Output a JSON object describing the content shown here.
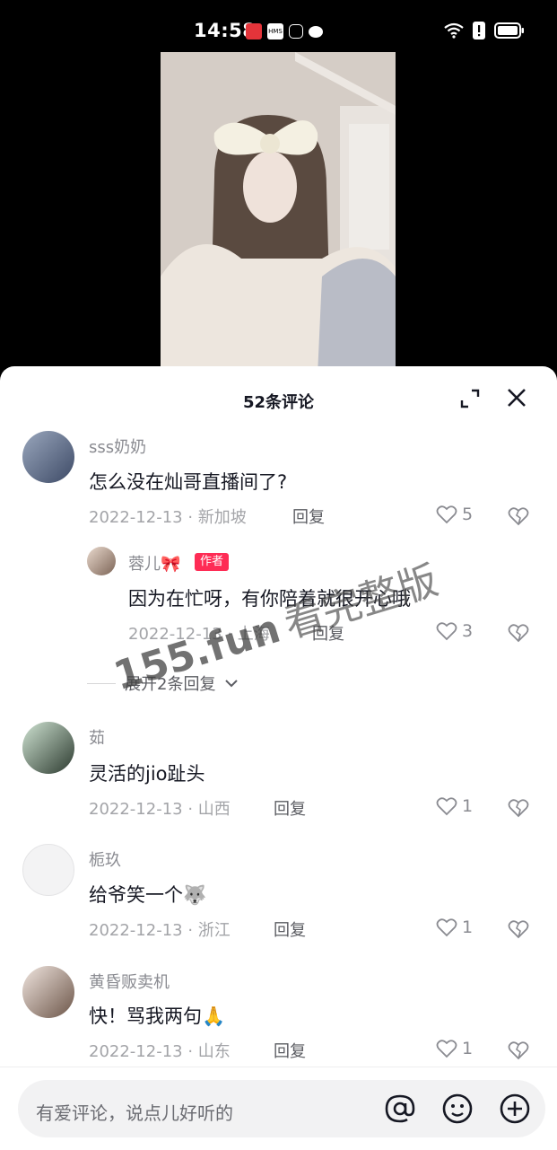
{
  "status": {
    "time": "14:58",
    "left_icons": [
      "app-notification-icon",
      "hms-icon",
      "shield-icon",
      "message-icon"
    ],
    "right_icons": [
      "wifi-icon",
      "alert-icon",
      "battery-icon"
    ]
  },
  "sheet": {
    "title": "52条评论"
  },
  "comments": [
    {
      "user": "sss奶奶",
      "text": "怎么没在灿哥直播间了?",
      "meta": "2022-12-13 · 新加坡",
      "reply_label": "回复",
      "likes": "5"
    },
    {
      "user": "蓉儿🎀",
      "badge": "作者",
      "text": "因为在忙呀，有你陪着就很开心哦",
      "meta": "2022-12-13 · 上海",
      "reply_label": "回复",
      "likes": "3"
    },
    {
      "user": "茹",
      "text": "灵活的jio趾头",
      "meta": "2022-12-13 · 山西",
      "reply_label": "回复",
      "likes": "1"
    },
    {
      "user": "栀玖",
      "text": "给爷笑一个🐺",
      "meta": "2022-12-13 · 浙江",
      "reply_label": "回复",
      "likes": "1"
    },
    {
      "user": "黄昏贩卖机",
      "text": "快！骂我两句🙏",
      "meta": "2022-12-13 · 山东",
      "reply_label": "回复",
      "likes": "1"
    }
  ],
  "expand_replies": "展开2条回复",
  "watermark": {
    "domain": "155.fun",
    "text": "看完整版"
  },
  "input": {
    "placeholder": "有爱评论，说点儿好听的"
  },
  "colors": {
    "accent": "#fe2c55",
    "text_primary": "#161823",
    "text_secondary": "#8a8b91"
  }
}
